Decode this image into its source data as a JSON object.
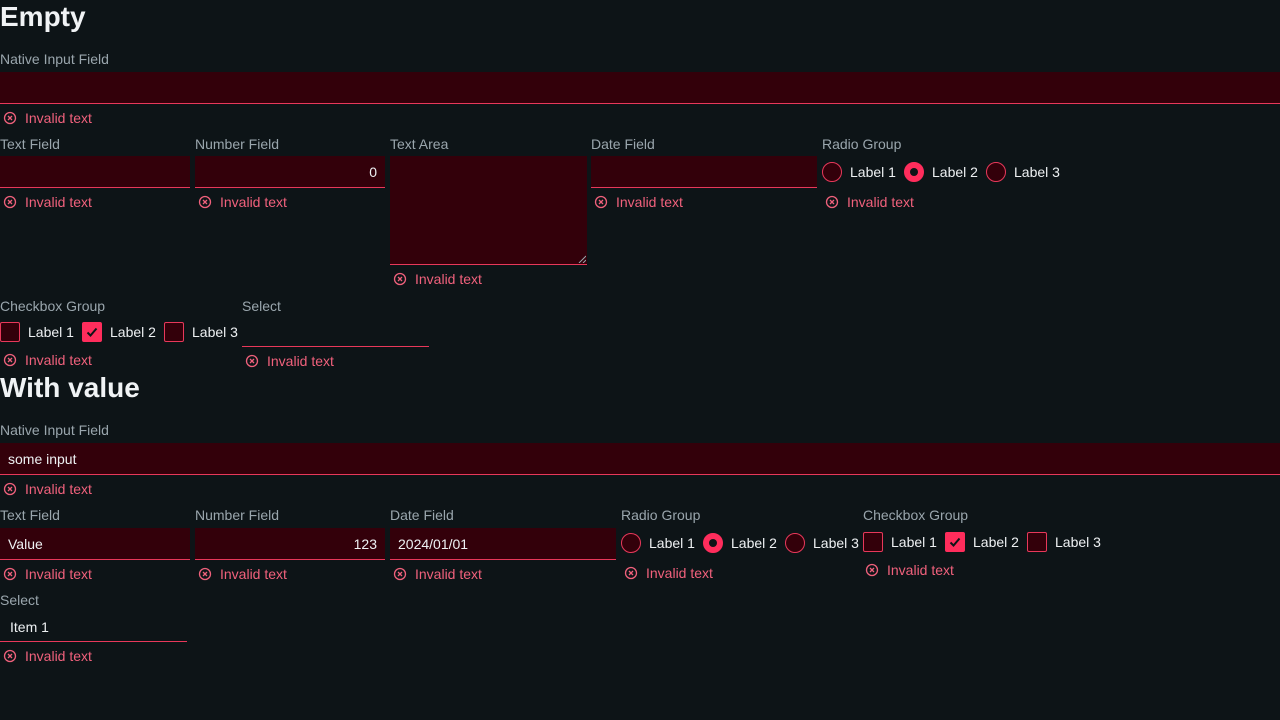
{
  "colors": {
    "background": "#0d1417",
    "field_bg": "#33000a",
    "invalid": "#e8385a",
    "error_text": "#f0617c",
    "checked": "#ff2d5c"
  },
  "empty": {
    "title": "Empty",
    "native_input": {
      "label": "Native Input Field",
      "value": "",
      "error": "Invalid text"
    },
    "text_field": {
      "label": "Text Field",
      "value": "",
      "error": "Invalid text"
    },
    "number_field": {
      "label": "Number Field",
      "value": "0",
      "error": "Invalid text"
    },
    "text_area": {
      "label": "Text Area",
      "value": "",
      "error": "Invalid text"
    },
    "date_field": {
      "label": "Date Field",
      "value": "",
      "error": "Invalid text"
    },
    "radio_group": {
      "label": "Radio Group",
      "options": [
        "Label 1",
        "Label 2",
        "Label 3"
      ],
      "selected": "Label 2",
      "error": "Invalid text"
    },
    "checkbox_group": {
      "label": "Checkbox Group",
      "options": [
        "Label 1",
        "Label 2",
        "Label 3"
      ],
      "checked": [
        "Label 2"
      ],
      "error": "Invalid text"
    },
    "select": {
      "label": "Select",
      "value": "",
      "error": "Invalid text"
    }
  },
  "with_value": {
    "title": "With value",
    "native_input": {
      "label": "Native Input Field",
      "value": "some input",
      "error": "Invalid text"
    },
    "text_field": {
      "label": "Text Field",
      "value": "Value",
      "error": "Invalid text"
    },
    "number_field": {
      "label": "Number Field",
      "value": "123",
      "error": "Invalid text"
    },
    "date_field": {
      "label": "Date Field",
      "value": "2024/01/01",
      "error": "Invalid text"
    },
    "radio_group": {
      "label": "Radio Group",
      "options": [
        "Label 1",
        "Label 2",
        "Label 3"
      ],
      "selected": "Label 2",
      "error": "Invalid text"
    },
    "checkbox_group": {
      "label": "Checkbox Group",
      "options": [
        "Label 1",
        "Label 2",
        "Label 3"
      ],
      "checked": [
        "Label 2"
      ],
      "error": "Invalid text"
    },
    "select": {
      "label": "Select",
      "value": "Item 1",
      "error": "Invalid text"
    }
  },
  "icons": {
    "error": "error-circle-x-icon",
    "check": "checkmark-icon",
    "resize": "resize-handle-icon"
  }
}
